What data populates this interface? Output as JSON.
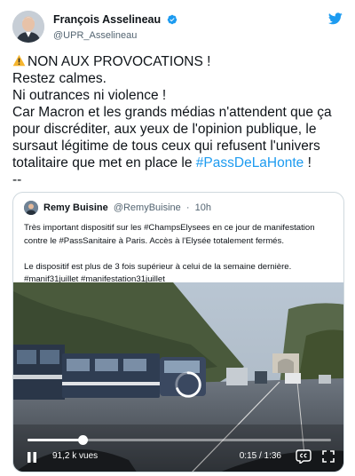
{
  "tweet": {
    "author": {
      "name": "François Asselineau",
      "handle": "@UPR_Asselineau",
      "verified_icon": "verified-badge-icon"
    },
    "logo_icon": "twitter-bird-icon",
    "text_lines": {
      "l1": "NON AUX PROVOCATIONS !",
      "l2": "Restez calmes.",
      "l3": "Ni outrances ni violence !",
      "l4": "Car Macron et les grands médias n'attendent que ça",
      "l5": "pour discréditer, aux yeux de l'opinion publique, le",
      "l6": "sursaut légitime de tous ceux qui refusent l'univers",
      "l7_prefix": "totalitaire que met en place le ",
      "l7_hashtag": "#PassDeLaHonte",
      "l7_suffix": " !",
      "l8": "--"
    },
    "warning_icon": "warning-icon",
    "colors": {
      "link": "#1d9bf0",
      "text": "#0f1419",
      "muted": "#536471",
      "border": "#cfd9de"
    }
  },
  "quote": {
    "author_name": "Remy Buisine",
    "handle": "@RemyBuisine",
    "separator": "·",
    "time": "10h",
    "text_lines": {
      "l1": "Très important dispositif sur les #ChampsElysees en ce jour de manifestation",
      "l2": "contre le #PassSanitaire à Paris. Accès à l'Elysée totalement fermés.",
      "l3": "",
      "l4": "Le dispositif est plus de 3 fois supérieur à celui de la semaine dernière.",
      "l5": "#manif31juillet #manifestation31juillet"
    },
    "video": {
      "views": "91,2 k vues",
      "timecode": "0:15 / 1:36",
      "progress_fraction": 0.18,
      "pause_icon": "pause-icon",
      "captions_icon": "closed-captions-icon",
      "fullscreen_icon": "fullscreen-icon",
      "loading_icon": "loading-spinner-icon"
    }
  }
}
